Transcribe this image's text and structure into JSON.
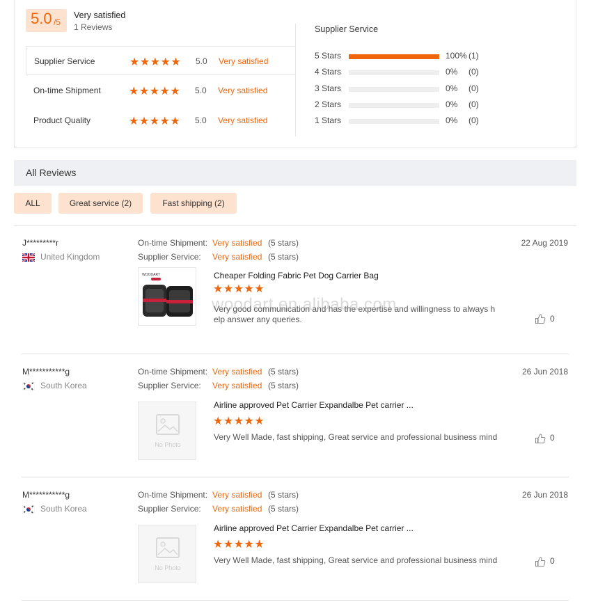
{
  "summary": {
    "score": "5.0",
    "score_out_of": "/5",
    "overall_label": "Very satisfied",
    "reviews_count": "1 Reviews",
    "rows": [
      {
        "label": "Supplier Service",
        "stars": "★★★★★",
        "score": "5.0",
        "text": "Very satisfied"
      },
      {
        "label": "On-time Shipment",
        "stars": "★★★★★",
        "score": "5.0",
        "text": "Very satisfied"
      },
      {
        "label": "Product Quality",
        "stars": "★★★★★",
        "score": "5.0",
        "text": "Very satisfied"
      }
    ],
    "breakdown_title": "Supplier Service",
    "breakdown": [
      {
        "label": "5  Stars",
        "fraction": 1.0,
        "pct": "100%",
        "count": "(1)"
      },
      {
        "label": "4  Stars",
        "fraction": 0,
        "pct": "0%",
        "count": "(0)"
      },
      {
        "label": "3  Stars",
        "fraction": 0,
        "pct": "0%",
        "count": "(0)"
      },
      {
        "label": "2  Stars",
        "fraction": 0,
        "pct": "0%",
        "count": "(0)"
      },
      {
        "label": "1  Stars",
        "fraction": 0,
        "pct": "0%",
        "count": "(0)"
      }
    ]
  },
  "all_reviews": {
    "title": "All Reviews",
    "filters": [
      "ALL",
      "Great service (2)",
      "Fast shipping (2)"
    ]
  },
  "reviews": [
    {
      "user": "J*********r",
      "country": "United Kingdom",
      "flag": "uk-flag-icon",
      "k1": "On-time Shipment:",
      "v1": "Very satisfied",
      "s1": "(5 stars)",
      "k2": "Supplier Service:",
      "v2": "Very satisfied",
      "s2": "(5 stars)",
      "date": "22 Aug 2019",
      "product_title": "Cheaper Folding Fabric Pet Dog Carrier Bag",
      "product_stars": "★★★★★",
      "text": "Very good communication and has the expertise and willingness to always h elp answer any queries.",
      "likes": "0",
      "thumb_brand": "WOODART"
    },
    {
      "user": "M***********g",
      "country": "South Korea",
      "flag": "korea-flag-icon",
      "k1": "On-time Shipment:",
      "v1": "Very satisfied",
      "s1": "(5 stars)",
      "k2": "Supplier Service:",
      "v2": "Very satisfied",
      "s2": "(5 stars)",
      "date": "26 Jun 2018",
      "product_title": "Airline approved Pet Carrier Expandalbe Pet carrier ...",
      "product_stars": "★★★★★",
      "text": "Very Well Made, fast shipping, Great service and professional business mind",
      "likes": "0",
      "no_photo": "No Photo"
    },
    {
      "user": "M***********g",
      "country": "South Korea",
      "flag": "korea-flag-icon",
      "k1": "On-time Shipment:",
      "v1": "Very satisfied",
      "s1": "(5 stars)",
      "k2": "Supplier Service:",
      "v2": "Very satisfied",
      "s2": "(5 stars)",
      "date": "26 Jun 2018",
      "product_title": "Airline approved Pet Carrier Expandalbe Pet carrier ...",
      "product_stars": "★★★★★",
      "text": "Very Well Made, fast shipping, Great service and professional business mind",
      "likes": "0",
      "no_photo": "No Photo"
    }
  ],
  "watermark": "WOODART.en.alibaba.com",
  "colors": {
    "accent": "#f0660a",
    "chip_bg": "#fde2cf",
    "header_bg": "#eef0f3"
  }
}
